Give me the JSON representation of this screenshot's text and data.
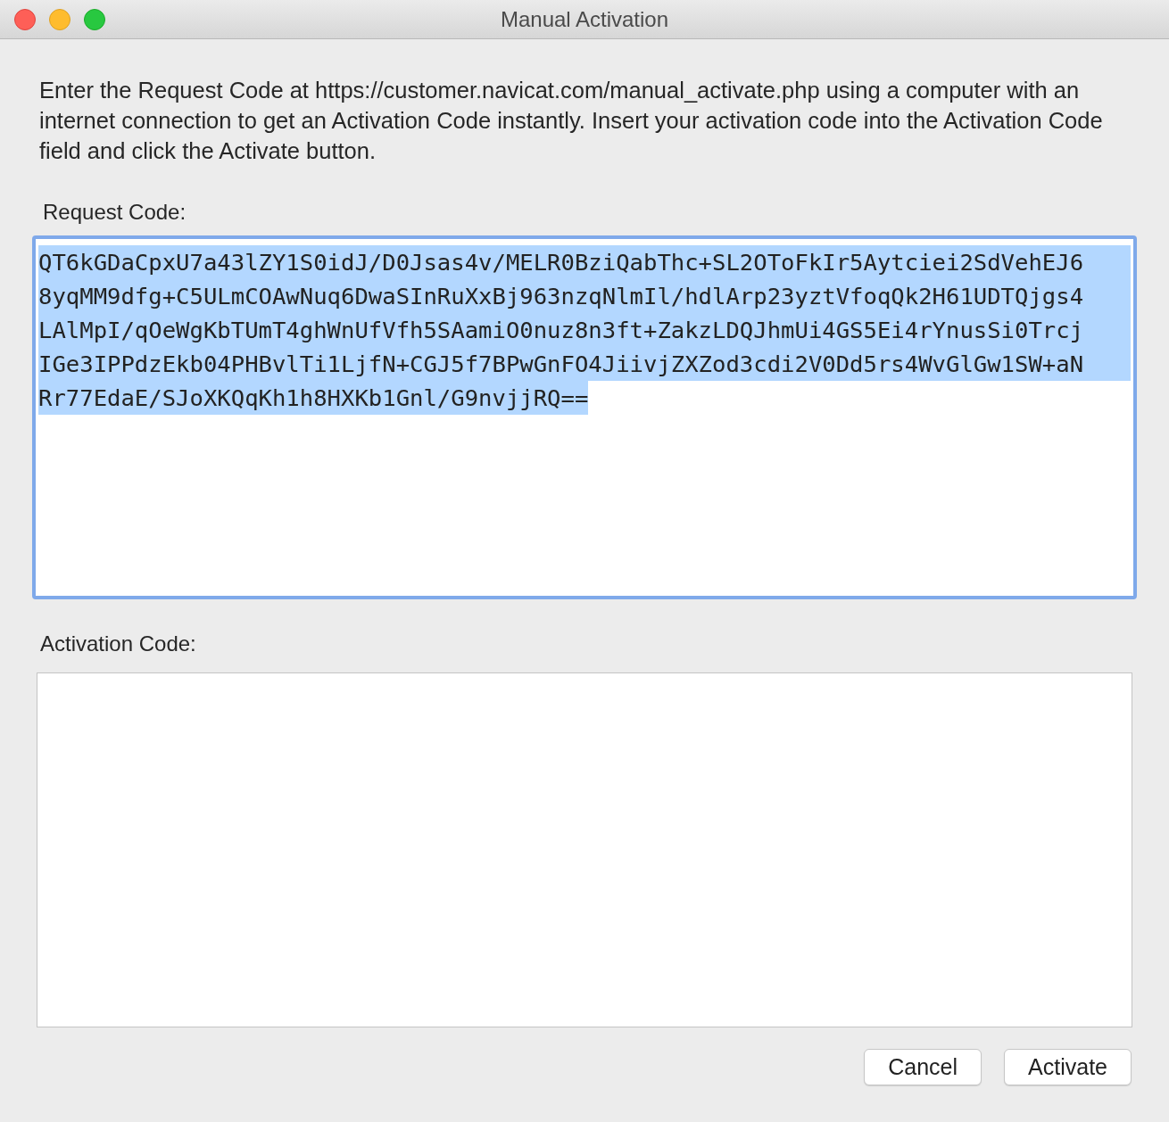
{
  "window": {
    "title": "Manual Activation"
  },
  "instructions": "Enter the Request Code at https://customer.navicat.com/manual_activate.php using a computer with an internet connection to get an Activation Code instantly. Insert your activation code into the Activation Code field and click the Activate button.",
  "request_code": {
    "label": "Request Code:",
    "focused": true,
    "selected": true,
    "lines": [
      "QT6kGDaCpxU7a43lZY1S0idJ/D0Jsas4v/MELR0BziQabThc+SL2OToFkIr5Aytciei2SdVehEJ6",
      "8yqMM9dfg+C5ULmCOAwNuq6DwaSInRuXxBj963nzqNlmIl/hdlArp23yztVfoqQk2H61UDTQjgs4",
      "LAlMpI/qOeWgKbTUmT4ghWnUfVfh5SAamiO0nuz8n3ft+ZakzLDQJhmUi4GS5Ei4rYnusSi0Trcj",
      "IGe3IPPdzEkb04PHBvlTi1LjfN+CGJ5f7BPwGnFO4JiivjZXZod3cdi2V0Dd5rs4WvGlGw1SW+aN",
      "Rr77EdaE/SJoXKQqKh1h8HXKb1Gnl/G9nvjjRQ=="
    ]
  },
  "activation_code": {
    "label": "Activation Code:",
    "focused": false
  },
  "buttons": [
    {
      "label": "Cancel"
    },
    {
      "label": "Activate"
    }
  ]
}
